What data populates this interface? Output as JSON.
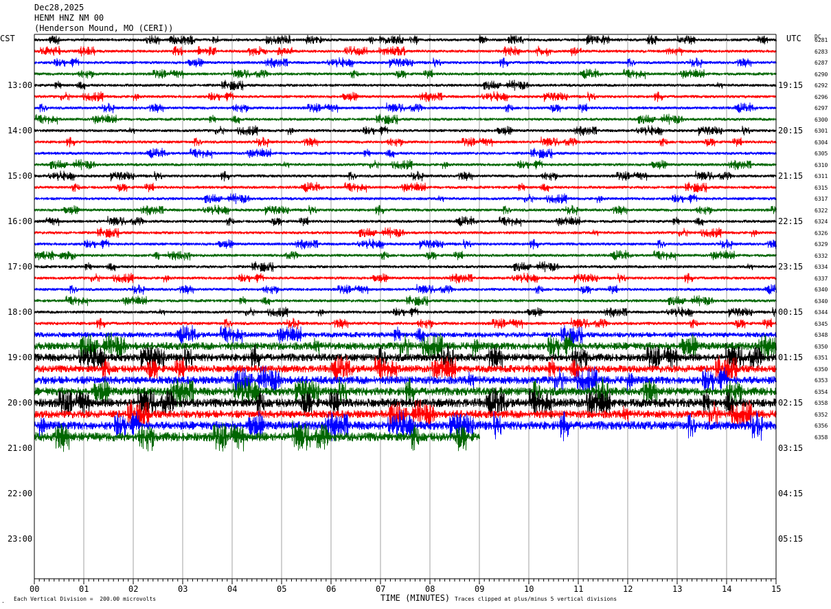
{
  "header": {
    "date": "Dec28,2025",
    "station": "HENM HNZ NM 00",
    "location": "(Henderson Mound, MO (CERI))"
  },
  "left_timezone": "CST",
  "right_timezone": "UTC",
  "dc_label": "DC",
  "footer": {
    "scale_note": "Each Vertical Division =  200.00 microvolts",
    "xlabel": "TIME (MINUTES)",
    "clip_note": "Traces clipped at plus/minus 5 vertical divisions"
  },
  "colors": {
    "black": "#000000",
    "red": "#ff0000",
    "blue": "#0000ff",
    "green": "#006600",
    "grid": "#a0a0a0"
  },
  "chart_data": {
    "type": "line",
    "title": "HENM HNZ NM 00",
    "xlabel": "TIME (MINUTES)",
    "xlim": [
      0,
      15
    ],
    "x_ticks": [
      "00",
      "01",
      "02",
      "03",
      "04",
      "05",
      "06",
      "07",
      "08",
      "09",
      "10",
      "11",
      "12",
      "13",
      "14",
      "15"
    ],
    "left_hour_labels": [
      "13:00",
      "14:00",
      "15:00",
      "16:00",
      "17:00",
      "18:00",
      "19:00",
      "20:00",
      "21:00",
      "22:00",
      "23:00"
    ],
    "right_hour_labels": [
      "19:15",
      "20:15",
      "21:15",
      "22:15",
      "23:15",
      "00:15",
      "01:15",
      "02:15",
      "03:15",
      "04:15",
      "05:15"
    ],
    "trace_color_cycle": [
      "black",
      "red",
      "blue",
      "green"
    ],
    "trace_count": 36,
    "last_trace_end_minute": 9.0,
    "dc_values": [
      "6281",
      "6283",
      "6287",
      "6290",
      "6292",
      "6296",
      "6297",
      "6300",
      "6301",
      "6304",
      "6305",
      "6310",
      "6311",
      "6315",
      "6317",
      "6322",
      "6324",
      "6326",
      "6329",
      "6332",
      "6334",
      "6337",
      "6340",
      "6340",
      "6344",
      "6345",
      "6348",
      "6350",
      "6351",
      "6350",
      "6353",
      "6354",
      "6358",
      "6352",
      "6356",
      "6358"
    ],
    "trace_noise_level": [
      1.0,
      1.0,
      1.0,
      1.0,
      1.0,
      1.0,
      1.0,
      1.0,
      1.0,
      1.0,
      1.0,
      1.0,
      1.0,
      1.0,
      1.0,
      1.0,
      1.0,
      1.0,
      1.0,
      1.0,
      1.0,
      1.0,
      1.0,
      1.0,
      1.0,
      1.1,
      1.8,
      2.6,
      2.6,
      2.5,
      2.7,
      2.8,
      3.0,
      2.7,
      2.9,
      3.1
    ]
  }
}
